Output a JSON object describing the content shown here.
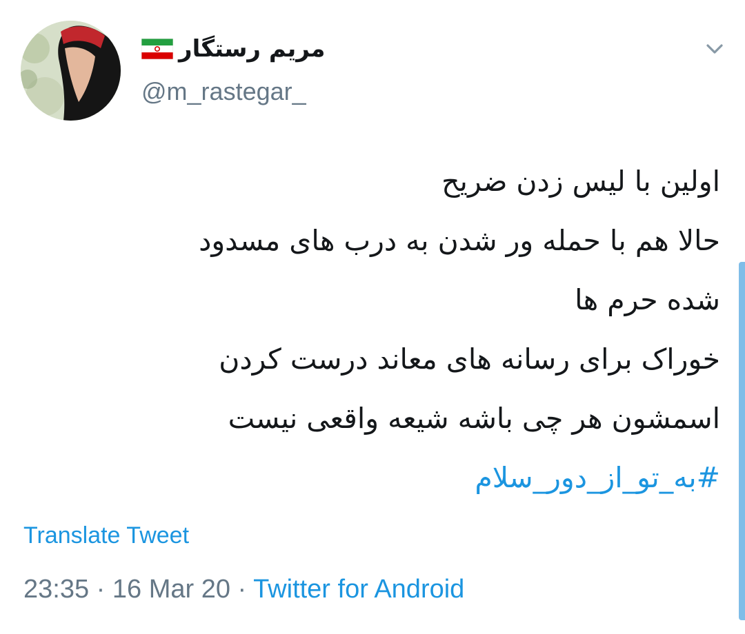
{
  "author": {
    "display_name": "مریم رستگار",
    "handle": "@m_rastegar_",
    "flag_icon": "iran-flag-icon",
    "avatar_icon": "profile-photo-avatar"
  },
  "menu": {
    "icon": "chevron-down-icon"
  },
  "tweet": {
    "lines": [
      "اولین با لیس زدن ضریح",
      "حالا هم با حمله ور شدن به درب های مسدود",
      "شده حرم ها",
      "خوراک برای رسانه های معاند درست کردن",
      "اسمشون هر چی باشه شیعه واقعی نیست"
    ],
    "hashtag": "#به_تو_از_دور_سلام"
  },
  "translate_label": "Translate Tweet",
  "meta": {
    "time": "23:35",
    "separator": " · ",
    "date": "16 Mar 20",
    "source": "Twitter for Android"
  },
  "colors": {
    "link": "#1b95e0",
    "muted": "#657786",
    "text": "#14171a",
    "flag_green": "#239f40",
    "flag_red": "#da0000"
  }
}
